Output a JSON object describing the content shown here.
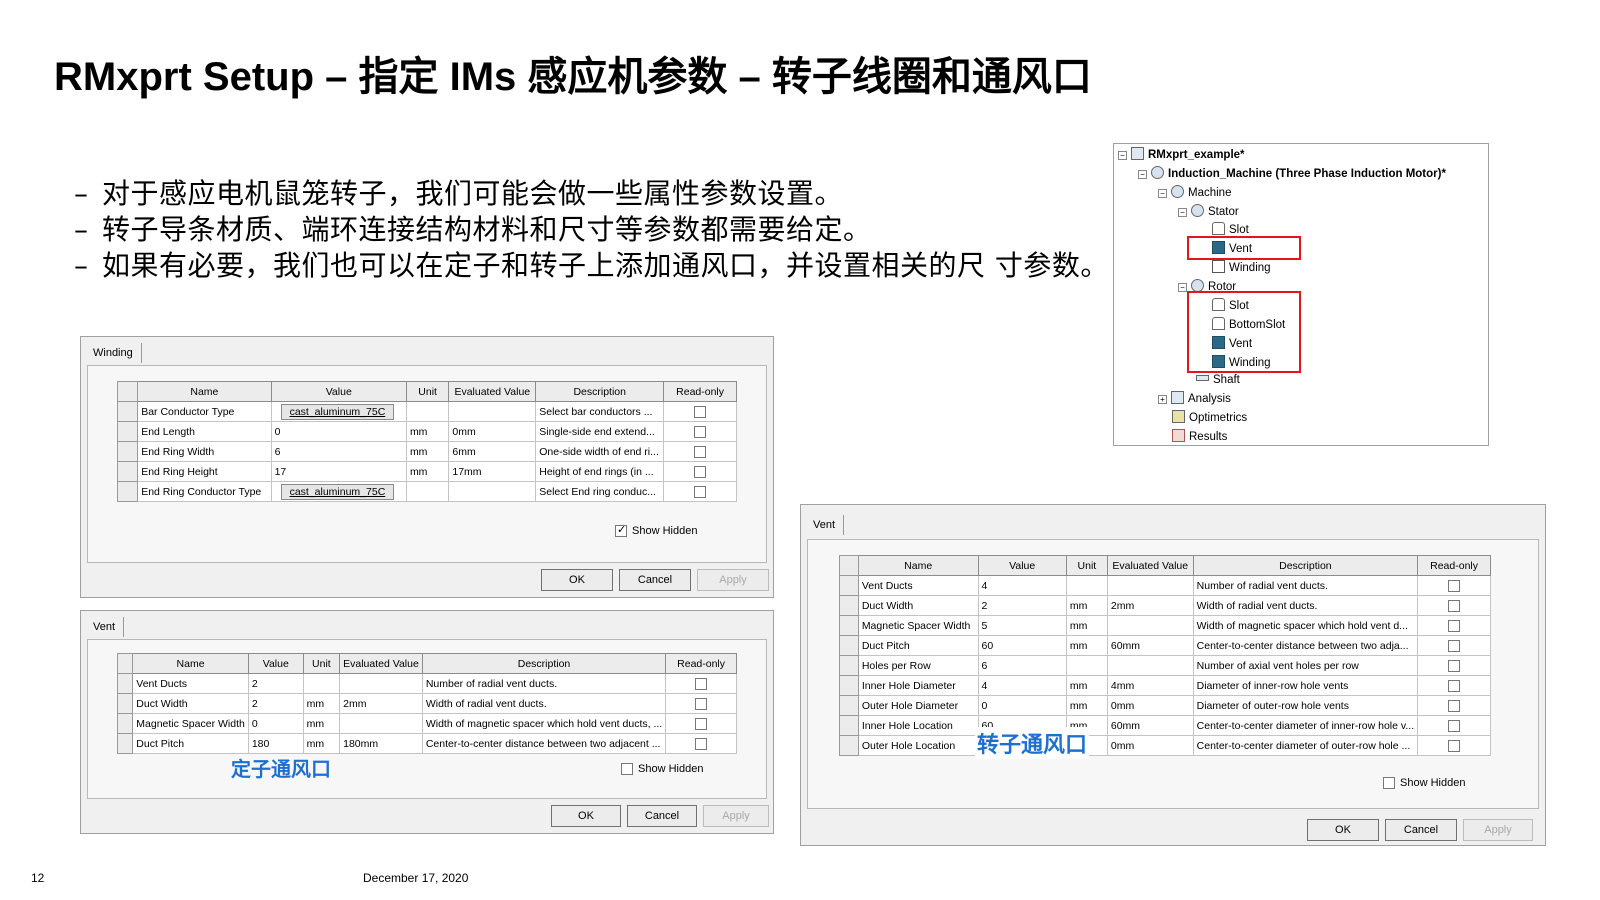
{
  "slide": {
    "title": "RMxprt Setup – 指定 IMs 感应机参数 – 转子线圈和通风口",
    "bullets": [
      "对于感应电机鼠笼转子，我们可能会做一些属性参数设置。",
      "转子导条材质、端环连接结构材料和尺寸等参数都需要给定。",
      "如果有必要，我们也可以在定子和转子上添加通风口，并设置相关的尺 寸参数。"
    ],
    "page_number": "12",
    "date": "December 17, 2020"
  },
  "winding_dialog": {
    "tab": "Winding",
    "columns": [
      "Name",
      "Value",
      "Unit",
      "Evaluated Value",
      "Description",
      "Read-only"
    ],
    "rows": [
      {
        "name": "Bar Conductor Type",
        "value": "cast_aluminum_75C",
        "unit": "",
        "evaluated": "",
        "desc": "Select bar conductors ..."
      },
      {
        "name": "End Length",
        "value": "0",
        "unit": "mm",
        "evaluated": "0mm",
        "desc": "Single-side end extend..."
      },
      {
        "name": "End Ring Width",
        "value": "6",
        "unit": "mm",
        "evaluated": "6mm",
        "desc": "One-side width of end ri..."
      },
      {
        "name": "End Ring Height",
        "value": "17",
        "unit": "mm",
        "evaluated": "17mm",
        "desc": "Height of  end rings (in ..."
      },
      {
        "name": "End Ring Conductor Type",
        "value": "cast_aluminum_75C",
        "unit": "",
        "evaluated": "",
        "desc": "Select End ring conduc..."
      }
    ],
    "show_hidden": "Show Hidden",
    "ok": "OK",
    "cancel": "Cancel",
    "apply": "Apply"
  },
  "stator_vent_dialog": {
    "tab": "Vent",
    "columns": [
      "Name",
      "Value",
      "Unit",
      "Evaluated Value",
      "Description",
      "Read-only"
    ],
    "rows": [
      {
        "name": "Vent Ducts",
        "value": "2",
        "unit": "",
        "evaluated": "",
        "desc": "Number of radial vent ducts."
      },
      {
        "name": "Duct Width",
        "value": "2",
        "unit": "mm",
        "evaluated": "2mm",
        "desc": "Width of radial vent ducts."
      },
      {
        "name": "Magnetic Spacer Width",
        "value": "0",
        "unit": "mm",
        "evaluated": "",
        "desc": "Width of magnetic spacer which hold vent ducts, ..."
      },
      {
        "name": "Duct Pitch",
        "value": "180",
        "unit": "mm",
        "evaluated": "180mm",
        "desc": "Center-to-center distance between two adjacent ..."
      }
    ],
    "caption": "定子通风口",
    "show_hidden": "Show Hidden",
    "ok": "OK",
    "cancel": "Cancel",
    "apply": "Apply"
  },
  "rotor_vent_dialog": {
    "tab": "Vent",
    "columns": [
      "Name",
      "Value",
      "Unit",
      "Evaluated Value",
      "Description",
      "Read-only"
    ],
    "rows": [
      {
        "name": "Vent Ducts",
        "value": "4",
        "unit": "",
        "evaluated": "",
        "desc": "Number of radial vent ducts."
      },
      {
        "name": "Duct Width",
        "value": "2",
        "unit": "mm",
        "evaluated": "2mm",
        "desc": "Width of radial vent ducts."
      },
      {
        "name": "Magnetic Spacer Width",
        "value": "5",
        "unit": "mm",
        "evaluated": "",
        "desc": "Width of magnetic spacer which hold vent d..."
      },
      {
        "name": "Duct Pitch",
        "value": "60",
        "unit": "mm",
        "evaluated": "60mm",
        "desc": "Center-to-center distance between two adja..."
      },
      {
        "name": "Holes per Row",
        "value": "6",
        "unit": "",
        "evaluated": "",
        "desc": "Number of axial vent holes per row"
      },
      {
        "name": "Inner Hole Diameter",
        "value": "4",
        "unit": "mm",
        "evaluated": "4mm",
        "desc": "Diameter of inner-row hole vents"
      },
      {
        "name": "Outer Hole Diameter",
        "value": "0",
        "unit": "mm",
        "evaluated": "0mm",
        "desc": "Diameter of outer-row hole vents"
      },
      {
        "name": "Inner Hole Location",
        "value": "60",
        "unit": "mm",
        "evaluated": "60mm",
        "desc": "Center-to-center diameter of inner-row hole v..."
      },
      {
        "name": "Outer Hole Location",
        "value": "",
        "unit": "mm",
        "evaluated": "0mm",
        "desc": "Center-to-center diameter of outer-row hole ..."
      }
    ],
    "caption": "转子通风口",
    "show_hidden": "Show Hidden",
    "ok": "OK",
    "cancel": "Cancel",
    "apply": "Apply"
  },
  "tree": {
    "project": "RMxprt_example*",
    "machine_design": "Induction_Machine (Three Phase Induction Motor)*",
    "machine": "Machine",
    "stator": "Stator",
    "stator_slot": "Slot",
    "stator_vent": "Vent",
    "stator_winding": "Winding",
    "rotor": "Rotor",
    "rotor_slot": "Slot",
    "rotor_bottomslot": "BottomSlot",
    "rotor_vent": "Vent",
    "rotor_winding": "Winding",
    "shaft": "Shaft",
    "analysis": "Analysis",
    "optimetrics": "Optimetrics",
    "results": "Results"
  }
}
